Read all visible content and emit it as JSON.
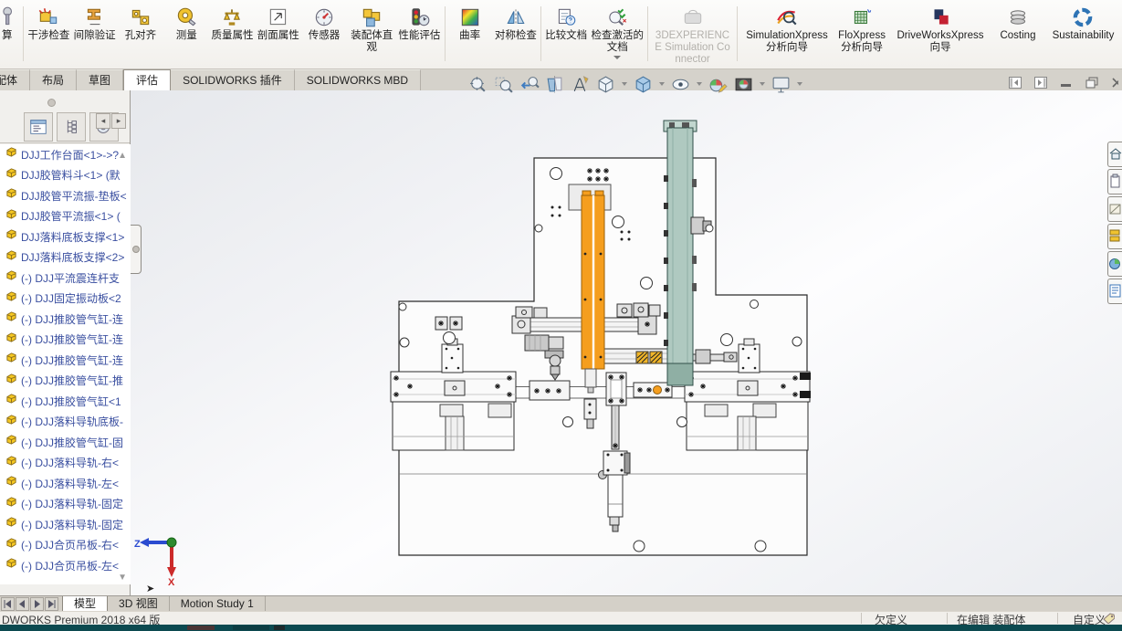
{
  "ribbon": {
    "buttons": [
      {
        "label": "算"
      },
      {
        "label": "干涉检查"
      },
      {
        "label": "间隙验证"
      },
      {
        "label": "孔对齐"
      },
      {
        "label": "测量"
      },
      {
        "label": "质量属性"
      },
      {
        "label": "剖面属性"
      },
      {
        "label": "传感器"
      },
      {
        "label": "装配体直观"
      },
      {
        "label": "性能评估"
      },
      {
        "label": "曲率"
      },
      {
        "label": "对称检查"
      },
      {
        "label": "比较文档"
      },
      {
        "label": "检查激活的文档"
      },
      {
        "label": "3DEXPERIENCE Simulation Connector"
      },
      {
        "label": "SimulationXpress 分析向导"
      },
      {
        "label": "FloXpress 分析向导"
      },
      {
        "label": "DriveWorksXpress 向导"
      },
      {
        "label": "Costing"
      },
      {
        "label": "Sustainability"
      }
    ]
  },
  "document_tabs": {
    "tabs": [
      "装配体",
      "布局",
      "草图",
      "评估",
      "SOLIDWORKS 插件",
      "SOLIDWORKS MBD"
    ],
    "active": "评估"
  },
  "view_toolbar": {
    "icons": [
      "zoom-to-fit",
      "zoom-to-area",
      "previous-view",
      "section-view",
      "dynamic-annotation",
      "view-orientation",
      "display-style",
      "hide-show-items",
      "edit-appearance",
      "apply-scene",
      "view-settings"
    ]
  },
  "feature_tree": {
    "items": [
      "DJJ工作台面<1>->?",
      "DJJ胶管料斗<1> (默",
      "DJJ胶管平流振-垫板<",
      "DJJ胶管平流振<1> (",
      "DJJ落料底板支撑<1>",
      "DJJ落料底板支撑<2>",
      "(-) DJJ平流震连杆支",
      "(-) DJJ固定振动板<2",
      "(-) DJJ推胶管气缸-连",
      "(-) DJJ推胶管气缸-连",
      "(-) DJJ推胶管气缸-连",
      "(-) DJJ推胶管气缸-推",
      "(-) DJJ推胶管气缸<1",
      "(-) DJJ落料导轨底板-",
      "(-) DJJ推胶管气缸-固",
      "(-) DJJ落料导轨-右<",
      "(-) DJJ落料导轨-左<",
      "(-) DJJ落料导轨-固定",
      "(-) DJJ落料导轨-固定",
      "(-) DJJ合页吊板-右<",
      "(-) DJJ合页吊板-左<"
    ]
  },
  "viewport": {
    "triad": {
      "z": "Z",
      "x": "X"
    }
  },
  "bottom_tabs": {
    "tabs": [
      "模型",
      "3D 视图",
      "Motion Study 1"
    ],
    "active": "模型"
  },
  "status_bar": {
    "app_version": "DWORKS Premium 2018 x64 版",
    "define_state": "欠定义",
    "edit_state": "在编辑 装配体",
    "customize": "自定义"
  },
  "colors": {
    "feeder_orange": "#F59E1E",
    "rail_teal": "#AFC9C0",
    "tree_text": "#3A4FA0",
    "taskbar_teal": "#0C4A50"
  }
}
